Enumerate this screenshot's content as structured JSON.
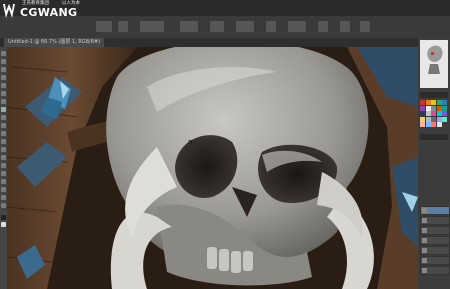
{
  "watermark": {
    "brand": "CGWANG",
    "tagline": "王氏教育集团",
    "tagline_cn": "以人为本"
  },
  "document": {
    "tab_title": "Untitled-1 @ 66.7% (图层 1, RGB/8#)"
  },
  "colors": {
    "accent": "#5b7fa6",
    "menubar": "#2b2b2b",
    "panel": "#3c3c3c"
  },
  "swatches": [
    "#c0392b",
    "#e67e22",
    "#f1c40f",
    "#27ae60",
    "#2980b9",
    "#8e44ad",
    "#ecf0f1",
    "#7f8c8d",
    "#d35400",
    "#16a085",
    "#2c3e50",
    "#bdc3c7",
    "#e84393",
    "#00cec9",
    "#6c5ce7",
    "#fdcb6e",
    "#b2bec3",
    "#636e72",
    "#a29bfe",
    "#55efc4",
    "#fab1a0",
    "#74b9ff",
    "#ff7675",
    "#dfe6e9"
  ]
}
